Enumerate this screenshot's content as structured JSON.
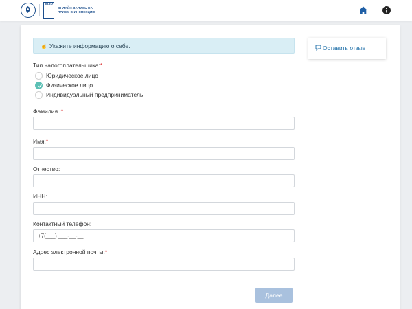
{
  "header": {
    "logo_badge": "М-02",
    "logo_title_line1": "ОНЛАЙН-ЗАПИСЬ НА",
    "logo_title_line2": "ПРИЕМ В ИНСПЕКЦИЮ",
    "brand_color": "#1b4e8c",
    "icons": [
      "home-icon",
      "info-icon"
    ]
  },
  "notice": {
    "text": "Укажите информацию о себе."
  },
  "feedback": {
    "label": "Оставить отзыв"
  },
  "taxpayer_type": {
    "label": "Тип налогоплательщика:",
    "required_mark": "*",
    "options": [
      {
        "label": "Юридическое лицо",
        "checked": false
      },
      {
        "label": "Физическое лицо",
        "checked": true
      },
      {
        "label": "Индивидуальный предприниматель",
        "checked": false
      }
    ]
  },
  "fields": {
    "surname": {
      "label": "Фамилия :",
      "required_mark": "*",
      "value": ""
    },
    "name": {
      "label": "Имя:",
      "required_mark": "*",
      "value": ""
    },
    "patronymic": {
      "label": "Отчество:",
      "value": ""
    },
    "inn": {
      "label": "ИНН:",
      "value": ""
    },
    "phone": {
      "label": "Контактный телефон:",
      "value": "+7(___) ___-__-__"
    },
    "email": {
      "label": "Адрес электронной почты:",
      "required_mark": "*",
      "value": ""
    }
  },
  "next_button": {
    "label": "Далее"
  },
  "colors": {
    "accent_radio": "#5cc0b5",
    "notice_bg": "#d9eef5",
    "button_disabled": "#a9c1de",
    "link": "#1f6fa8",
    "required": "#dd3333"
  }
}
